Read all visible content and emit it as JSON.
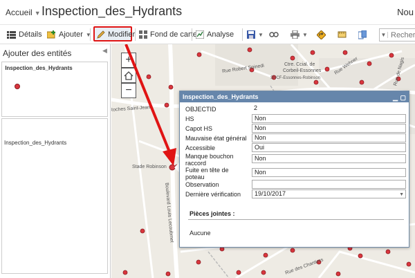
{
  "header": {
    "home_label": "Accueil",
    "title": "Inspection_des_Hydrants",
    "user_label": "Nou"
  },
  "toolbar": {
    "details_label": "Détails",
    "add_label": "Ajouter",
    "edit_label": "Modifier",
    "basemap_label": "Fond de carte",
    "analysis_label": "Analyse",
    "search_placeholder": "Recherc"
  },
  "side_panel": {
    "title": "Ajouter des entités",
    "template_layer_name": "Inspection_des_Hydrants",
    "template_item_label": "Inspection_des_Hydrants"
  },
  "map": {
    "labels": {
      "robert_spinedi": "Rue Robert Spinedi",
      "ctre_ccial": "Ctre. Ccial. de",
      "corbeil": "Corbeil-Essonnes",
      "sncf": "SNCF-Essonnes-Robinson",
      "stade": "Stade Robinson",
      "roches": "Roches Saint-Jean",
      "boulevard": "Boulevard Louis Lecoubmet",
      "rue_wehner": "Rue Wehner",
      "rue_nagis": "Rue de Nagis",
      "chantiers": "Rue des Chantiers"
    },
    "accent_point_color": "#d9363e"
  },
  "popup": {
    "title": "Inspection_des_Hydrants",
    "fields": [
      {
        "label": "OBJECTID",
        "value": "2"
      },
      {
        "label": "HS",
        "value": "Non"
      },
      {
        "label": "Capot HS",
        "value": "Non"
      },
      {
        "label": "Mauvaise état général",
        "value": "Non"
      },
      {
        "label": "Accessible",
        "value": "Oui"
      },
      {
        "label": "Manque bouchon raccord",
        "value": "Non"
      },
      {
        "label": "Fuite en tête de poteau",
        "value": "Non"
      },
      {
        "label": "Observation",
        "value": ""
      },
      {
        "label": "Dernière vérification",
        "value": "19/10/2017"
      }
    ],
    "attachments_title": "Pièces jointes :",
    "attachments_none": "Aucune"
  },
  "colors": {
    "popup_header": "#6686ab",
    "highlight_red": "#e01414"
  }
}
